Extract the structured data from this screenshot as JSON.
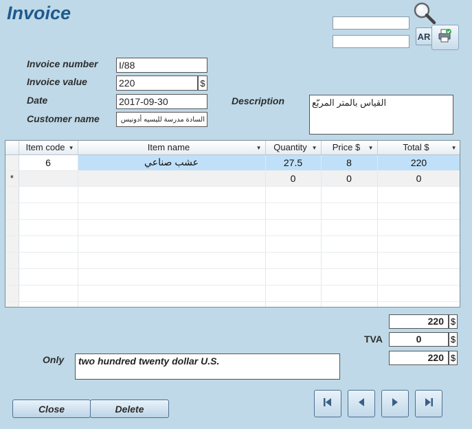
{
  "form": {
    "title": "Invoice"
  },
  "toolbar": {
    "search_1_value": "",
    "search_2_value": "",
    "ar_label": "AR",
    "icons": [
      "magnifier-icon",
      "print-icon"
    ]
  },
  "header": {
    "invoice_number_label": "Invoice number",
    "invoice_number": "I/88",
    "invoice_value_label": "Invoice value",
    "invoice_value": "220",
    "currency": "$",
    "date_label": "Date",
    "date": "2017-09-30",
    "customer_label": "Customer name",
    "customer": "السادة مدرسة لليسيه أدونيس",
    "description_label": "Description",
    "description": "القياس بالمتر المربّع"
  },
  "grid": {
    "columns": [
      "Item code",
      "Item name",
      "Quantity",
      "Price $",
      "Total $"
    ],
    "rows": [
      {
        "code": "6",
        "name": "عشب صناعي",
        "quantity": "27.5",
        "price": "8",
        "total": "220"
      }
    ],
    "new_row": {
      "marker": "*",
      "quantity": "0",
      "price": "0",
      "total": "0"
    }
  },
  "totals": {
    "subtotal": "220",
    "tva_label": "TVA",
    "tva": "0",
    "total": "220",
    "currency": "$"
  },
  "words": {
    "label": "Only",
    "value": "two hundred twenty dollar U.S."
  },
  "buttons": {
    "close": "Close",
    "delete": "Delete"
  },
  "colors": {
    "background": "#bfd9e8",
    "title": "#1f5a8c",
    "selected_cell": "#bfe0f8"
  }
}
